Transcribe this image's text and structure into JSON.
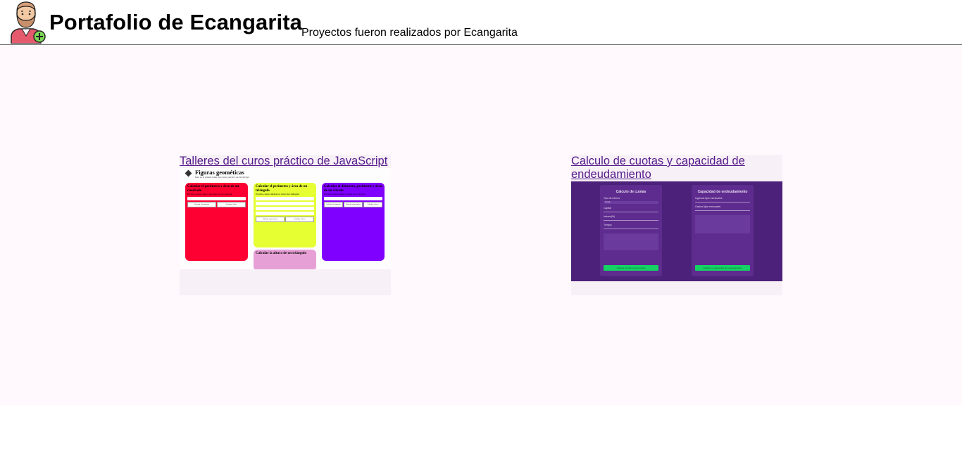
{
  "header": {
    "title": "Portafolio de Ecangarita",
    "subtitle": "Proyectos fueron realizados por Ecangarita",
    "avatar_icon": "bearded-man-avatar-icon"
  },
  "projects": [
    {
      "link_text": "Talleres del curos práctico de JavaScript",
      "preview": {
        "title": "Figuras geométicas",
        "subtitle": "Este es el primer taller del curso práctico de JavaScript",
        "panels": [
          {
            "color": "#ff0033",
            "heading": "Calcular el perímetro y área de un cuadrado",
            "label": "Escribe cuanto mide cada lado de tu cuadrado",
            "btn1": "Calcular el perímetro",
            "btn2": "Calcular el área"
          },
          {
            "color": "#e6ff33",
            "heading": "Calcular el perímetro y área de un triángulo",
            "label": "Escribe cuanto miden los lados del triángulo",
            "btn1": "Calcular el perímetro",
            "btn2": "Calcular el área"
          },
          {
            "color": "#8000ff",
            "heading": "Calcular el diámetro, perímetro y área de un círculo",
            "label": "Escribe cuanto mide el radio de tu círculo",
            "btn1": "Calcular el diámetro",
            "btn2": "Calcular el perímetro",
            "btn3": "Calcular el área"
          }
        ],
        "extra_panel": {
          "color": "#e7a0d6",
          "heading": "Calcular la altura de un triángulo"
        }
      }
    },
    {
      "link_text": "Calculo de cuotas y capacidad de endeudamiento",
      "preview": {
        "left": {
          "title": "Calculo de cuotas",
          "labels": [
            "Tipo de interes",
            "Capital",
            "Interes(%)",
            "Tiempo"
          ],
          "select_value": "Simple",
          "button": "Calcular el valor de sus cuotas"
        },
        "right": {
          "title": "Capacidad de endeudamiento",
          "labels": [
            "Ingresos fijos mensuales",
            "Gastos fijos mensuales"
          ],
          "button": "Calcular su capacidad de endeudamiento"
        }
      }
    }
  ],
  "colors": {
    "main_background": "#fff8fd",
    "card_background": "#f7f0f6",
    "link": "#551a8b",
    "purple_app": "#4b2179",
    "green_button": "#14d364"
  }
}
